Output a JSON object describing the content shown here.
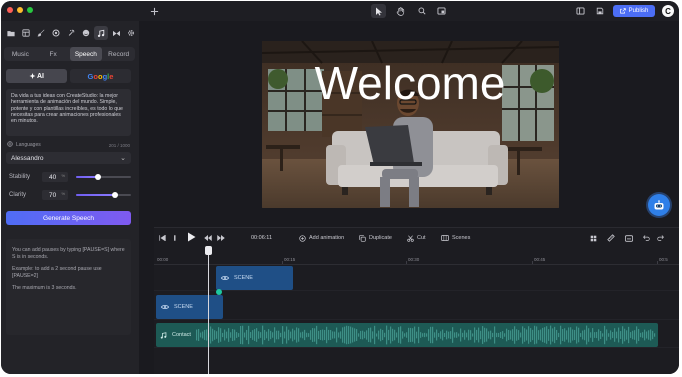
{
  "colors": {
    "accent": "#4c6ef5",
    "accent_purple": "#7f5af0",
    "scene_clip": "#1f4f86",
    "audio_clip": "#1d5a55",
    "panel_bg": "#232328",
    "window_bg": "#1a1a1f"
  },
  "window": {
    "traffic_lights": [
      "#ff5f57",
      "#febc2e",
      "#28c840"
    ]
  },
  "topbar": {
    "add_icon": "plus-icon",
    "tools": [
      {
        "name": "cursor-icon",
        "active": true
      },
      {
        "name": "hand-icon",
        "active": false
      },
      {
        "name": "search-icon",
        "active": false
      },
      {
        "name": "frame-icon",
        "active": false
      }
    ],
    "right_icons": [
      "layout-icon",
      "save-icon"
    ],
    "publish_label": "Publish",
    "avatar_letter": "C"
  },
  "sidebar": {
    "icon_rail": [
      "folder-icon",
      "layout-icon",
      "brush-icon",
      "shape-icon",
      "effects-icon",
      "sticker-icon",
      "music-icon",
      "transition-icon",
      "settings-icon"
    ],
    "active_icon": "music-icon",
    "tabs": [
      "Music",
      "Fx",
      "Speech",
      "Record"
    ],
    "active_tab": "Speech",
    "voice_providers": [
      {
        "label": "AI",
        "active": true
      },
      {
        "label": "Google",
        "active": false
      }
    ],
    "speech_text": "Da vida a tus ideas con CreateStudio: la mejor herramienta de animación del mundo. Simple, potente y con plantillas increíbles, es todo lo que necesitas para crear animaciones profesionales en minutos.",
    "languages_label": "Languages",
    "char_count": "201 / 1000",
    "voice": "Alessandro",
    "stability": {
      "label": "Stability",
      "value": "40",
      "unit": "%",
      "level": 0.4
    },
    "clarity": {
      "label": "Clarity",
      "value": "70",
      "unit": "%",
      "level": 0.7
    },
    "generate_label": "Generate Speech",
    "info": [
      "You can add pauses by typing [PAUSE=S] where S is in seconds.",
      "Example: to add a 2 second pause use [PAUSE=2]",
      "The maximum is 3 seconds."
    ]
  },
  "preview": {
    "headline": "Welcome"
  },
  "timeline": {
    "time": "00:06:11",
    "actions": [
      "Add animation",
      "Duplicate",
      "Cut",
      "Scenes"
    ],
    "ruler_ticks": [
      "00:00",
      "00:15",
      "00:30",
      "00:45",
      "00:5"
    ],
    "clips": {
      "scene_a": "SCENE",
      "scene_b": "SCENE",
      "audio": "Contact"
    }
  }
}
